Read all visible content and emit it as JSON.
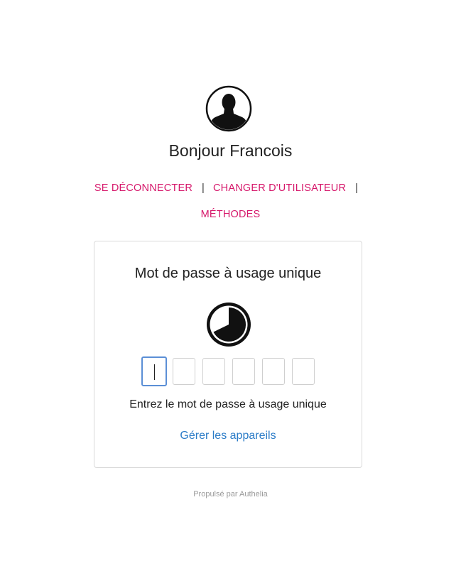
{
  "user": {
    "greeting": "Bonjour Francois",
    "avatar_icon": "user-silhouette-icon"
  },
  "nav": {
    "logout_label": "SE DÉCONNECTER",
    "switch_user_label": "CHANGER D'UTILISATEUR",
    "methods_label": "MÉTHODES",
    "separator": "|"
  },
  "otp_card": {
    "title": "Mot de passe à usage unique",
    "timer_icon": "countdown-timer-icon",
    "digit_count": 6,
    "digits": [
      "",
      "",
      "",
      "",
      "",
      ""
    ],
    "hint": "Entrez le mot de passe à usage unique",
    "manage_devices_label": "Gérer les appareils"
  },
  "footer": {
    "powered_by": "Propulsé par Authelia"
  },
  "colors": {
    "accent_link": "#d6186b",
    "manage_link": "#2a7bc7",
    "active_input_border": "#5b8fd6"
  }
}
